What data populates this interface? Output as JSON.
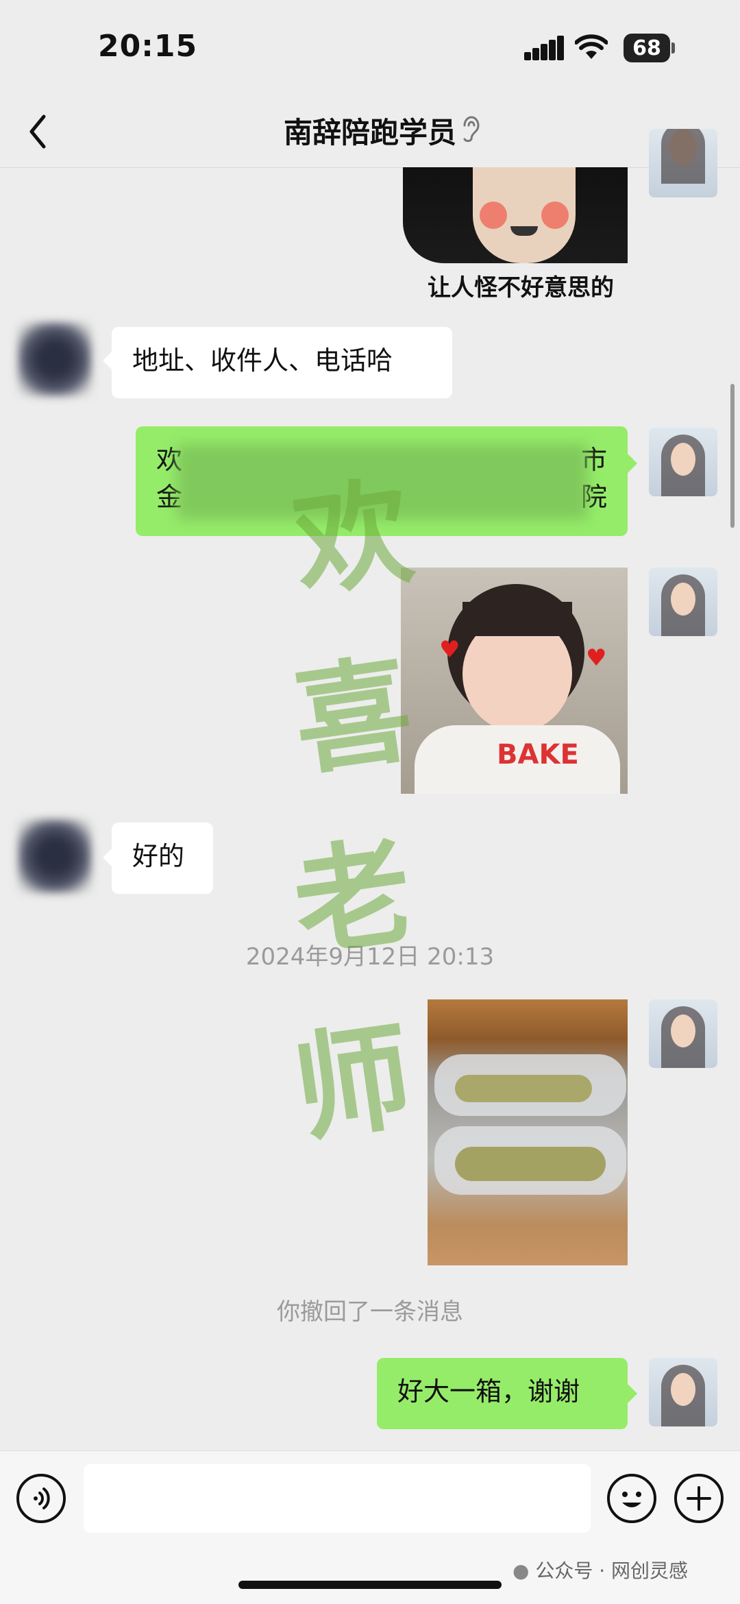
{
  "status": {
    "time": "20:15",
    "battery": "68"
  },
  "chat": {
    "title": "南辞陪跑学员"
  },
  "messages": {
    "sticker_caption": "让人怪不好意思的",
    "in_address": "地址、收件人、电话哈",
    "out_address_line1_start": "欢",
    "out_address_line1_end": "市",
    "out_address_line2_start": "金",
    "out_address_line2_end": "院",
    "in_ok": "好的",
    "timestamp": "2024年9月12日 20:13",
    "recall_notice": "你撤回了一条消息",
    "out_thanks": "好大一箱，谢谢",
    "photo_girl_shirt": "BAKE"
  },
  "watermark": {
    "chars": [
      "欢",
      "喜",
      "老",
      "师"
    ]
  },
  "footer": {
    "mark": "公众号 · 网创灵感"
  },
  "colors": {
    "bubble_out": "#95ec69",
    "bubble_in": "#ffffff",
    "background": "#ededed"
  },
  "icons": [
    "back-arrow-icon",
    "ear-icon",
    "more-icon",
    "voice-icon",
    "emoji-icon",
    "plus-icon",
    "wechat-icon"
  ]
}
